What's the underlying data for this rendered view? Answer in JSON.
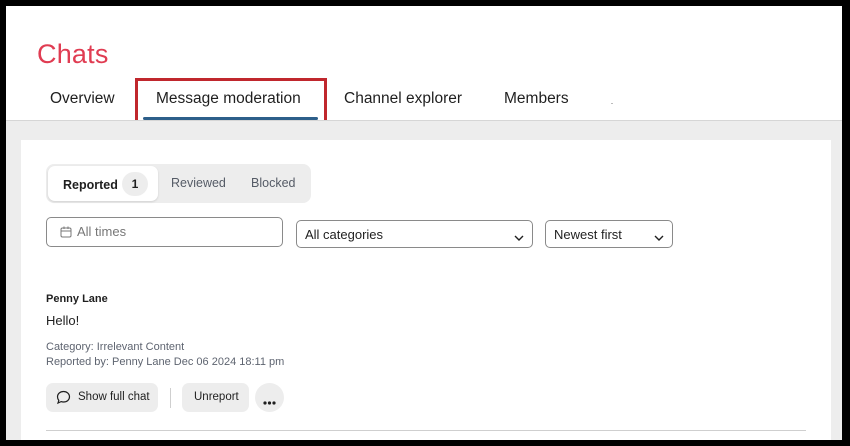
{
  "app": {
    "title": "Chats"
  },
  "tabs": [
    {
      "label": "Overview"
    },
    {
      "label": "Message moderation"
    },
    {
      "label": "Channel explorer"
    },
    {
      "label": "Members"
    }
  ],
  "active_tab": "Message moderation",
  "status_tabs": {
    "reported_label": "Reported",
    "reported_count": "1",
    "reviewed_label": "Reviewed",
    "blocked_label": "Blocked"
  },
  "filters": {
    "date_placeholder": "All times",
    "category_value": "All categories",
    "sort_value": "Newest first"
  },
  "report": {
    "author": "Penny Lane",
    "message": "Hello!",
    "category": "Category: Irrelevant Content",
    "reported_by": "Reported by: Penny Lane Dec 06 2024 18:11 pm"
  },
  "actions": {
    "show_full_chat": "Show full chat",
    "unreport": "Unreport"
  },
  "colors": {
    "brand": "#e03c52",
    "highlight": "#c0272d",
    "tab_underline": "#2d5f8a"
  },
  "icons": {
    "calendar": "calendar-icon",
    "chevron": "chevron-down-icon",
    "chat": "chat-bubble-icon",
    "more": "more-horizontal-icon"
  }
}
